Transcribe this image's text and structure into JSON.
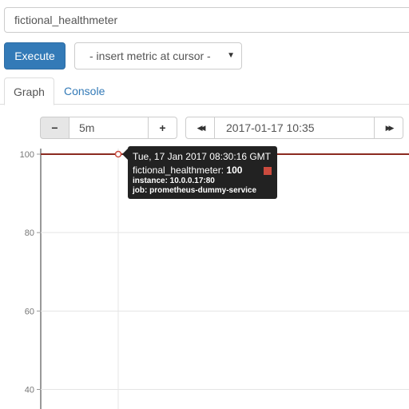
{
  "query": {
    "value": "fictional_healthmeter"
  },
  "toolbar": {
    "execute_label": "Execute",
    "metric_select": "- insert metric at cursor -"
  },
  "tabs": [
    {
      "label": "Graph",
      "active": true
    },
    {
      "label": "Console",
      "active": false
    }
  ],
  "controls": {
    "minus_label": "−",
    "range_value": "5m",
    "plus_label": "+",
    "back_label": "◀◀",
    "end_time": "2017-01-17 10:35",
    "forward_label": "▶▶"
  },
  "chart_data": {
    "type": "line",
    "y_ticks": [
      "100",
      "80",
      "60",
      "40"
    ],
    "ylim": [
      38,
      100
    ],
    "series": [
      {
        "values": [
          100,
          100,
          100
        ],
        "color": "#8b2a20"
      }
    ],
    "grid": true
  },
  "tooltip": {
    "time": "Tue, 17 Jan 2017 08:30:16 GMT",
    "metric_name": "fictional_healthmeter:",
    "metric_value": "100",
    "instance": "instance: 10.0.0.17:80",
    "job": "job: prometheus-dummy-service",
    "swatch_color": "#cb4b3e"
  }
}
